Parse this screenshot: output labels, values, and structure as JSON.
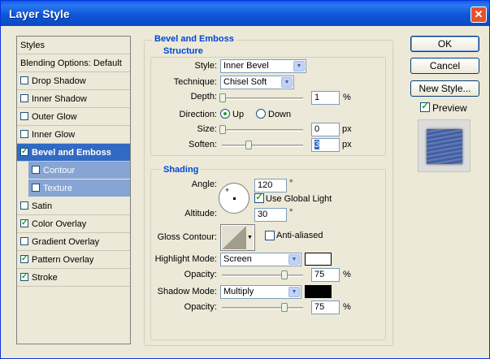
{
  "window": {
    "title": "Layer Style",
    "close_icon": "close-icon"
  },
  "left_panel": {
    "header": "Styles",
    "items": [
      {
        "label": "Blending Options: Default",
        "checkbox": false,
        "checked": false,
        "selected": false,
        "sub": false
      },
      {
        "label": "Drop Shadow",
        "checkbox": true,
        "checked": false,
        "selected": false,
        "sub": false
      },
      {
        "label": "Inner Shadow",
        "checkbox": true,
        "checked": false,
        "selected": false,
        "sub": false
      },
      {
        "label": "Outer Glow",
        "checkbox": true,
        "checked": false,
        "selected": false,
        "sub": false
      },
      {
        "label": "Inner Glow",
        "checkbox": true,
        "checked": false,
        "selected": false,
        "sub": false
      },
      {
        "label": "Bevel and Emboss",
        "checkbox": true,
        "checked": true,
        "selected": true,
        "sub": false
      },
      {
        "label": "Contour",
        "checkbox": true,
        "checked": false,
        "selected": false,
        "sub": true
      },
      {
        "label": "Texture",
        "checkbox": true,
        "checked": false,
        "selected": false,
        "sub": true
      },
      {
        "label": "Satin",
        "checkbox": true,
        "checked": false,
        "selected": false,
        "sub": false
      },
      {
        "label": "Color Overlay",
        "checkbox": true,
        "checked": true,
        "selected": false,
        "sub": false
      },
      {
        "label": "Gradient Overlay",
        "checkbox": true,
        "checked": false,
        "selected": false,
        "sub": false
      },
      {
        "label": "Pattern Overlay",
        "checkbox": true,
        "checked": true,
        "selected": false,
        "sub": false
      },
      {
        "label": "Stroke",
        "checkbox": true,
        "checked": true,
        "selected": false,
        "sub": false
      }
    ]
  },
  "bevel": {
    "group_title": "Bevel and Emboss",
    "structure_title": "Structure",
    "style_label": "Style:",
    "style_value": "Inner Bevel",
    "technique_label": "Technique:",
    "technique_value": "Chisel Soft",
    "depth_label": "Depth:",
    "depth_value": "1",
    "depth_unit": "%",
    "direction_label": "Direction:",
    "direction_up": "Up",
    "direction_down": "Down",
    "direction_selected": "Up",
    "size_label": "Size:",
    "size_value": "0",
    "size_unit": "px",
    "soften_label": "Soften:",
    "soften_value": "3",
    "soften_unit": "px"
  },
  "shading": {
    "title": "Shading",
    "angle_label": "Angle:",
    "angle_value": "120",
    "angle_unit": "°",
    "global_light_label": "Use Global Light",
    "global_light_checked": true,
    "altitude_label": "Altitude:",
    "altitude_value": "30",
    "altitude_unit": "°",
    "gloss_contour_label": "Gloss Contour:",
    "anti_aliased_label": "Anti-aliased",
    "anti_aliased_checked": false,
    "highlight_mode_label": "Highlight Mode:",
    "highlight_mode_value": "Screen",
    "highlight_color": "#ffffff",
    "highlight_opacity_label": "Opacity:",
    "highlight_opacity_value": "75",
    "highlight_opacity_unit": "%",
    "shadow_mode_label": "Shadow Mode:",
    "shadow_mode_value": "Multiply",
    "shadow_color": "#000000",
    "shadow_opacity_label": "Opacity:",
    "shadow_opacity_value": "75",
    "shadow_opacity_unit": "%"
  },
  "buttons": {
    "ok": "OK",
    "cancel": "Cancel",
    "new_style": "New Style...",
    "preview_label": "Preview",
    "preview_checked": true
  },
  "colors": {
    "title_bar": "#0a5fe9",
    "selected": "#316ac5",
    "sub_item": "#86a4d4",
    "group_title": "#0046d5"
  }
}
